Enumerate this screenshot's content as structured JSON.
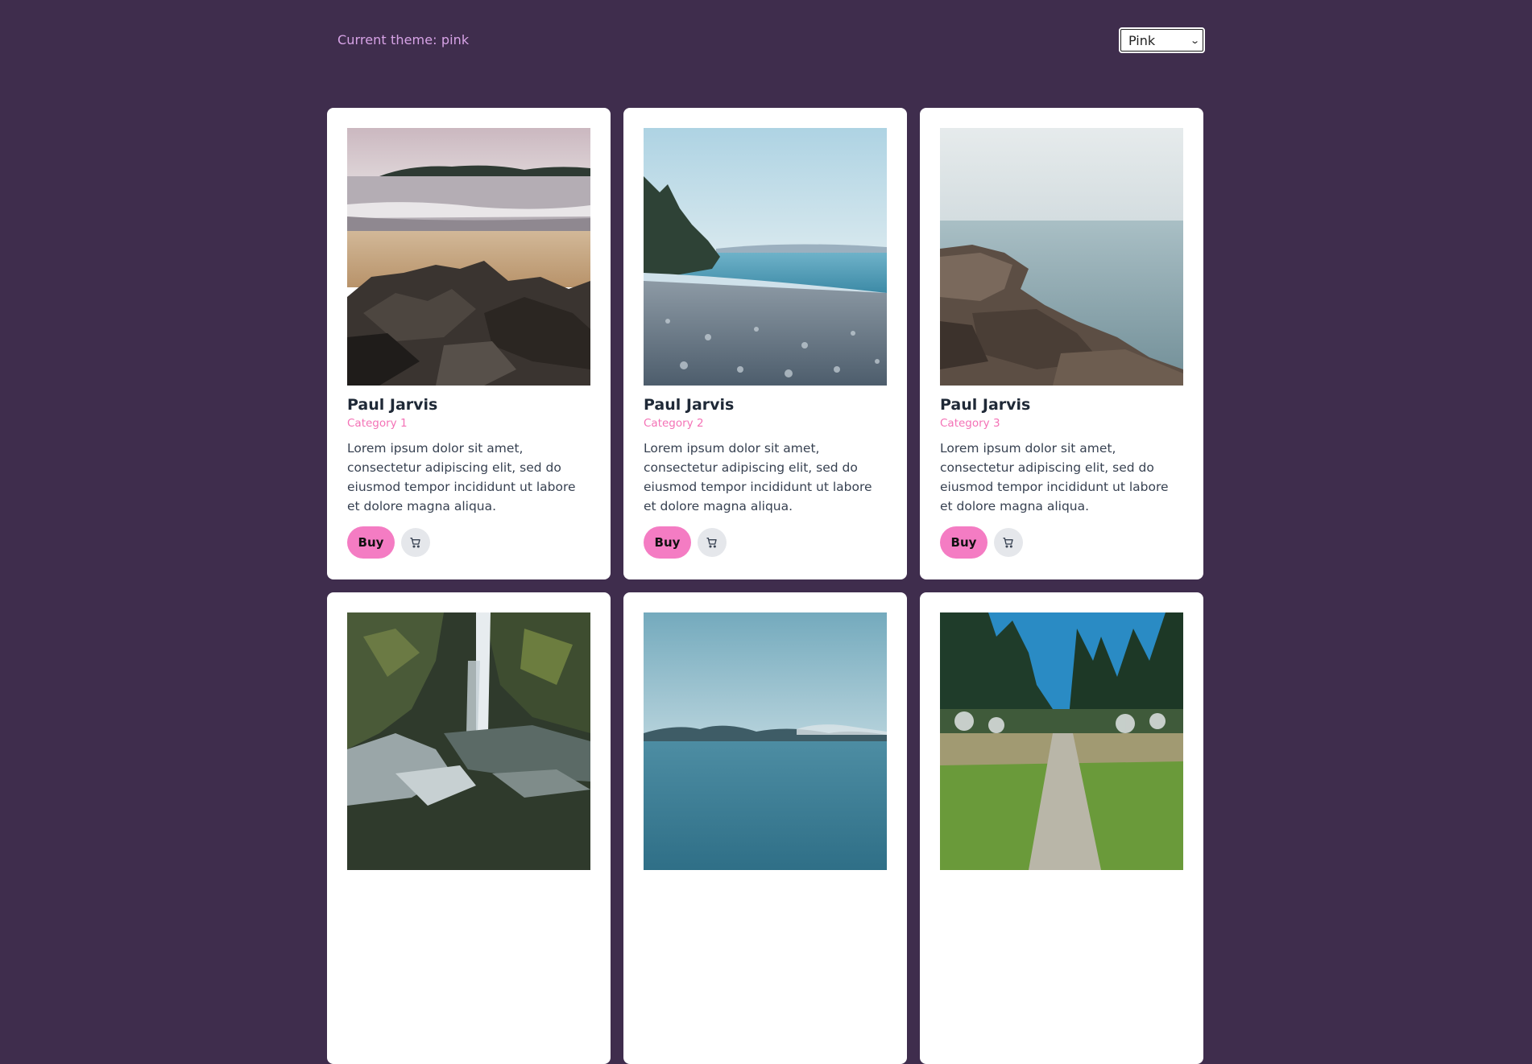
{
  "header": {
    "theme_label": "Current theme: pink",
    "theme_select": {
      "selected": "Pink"
    }
  },
  "colors": {
    "page_background": "#3f2d4d",
    "accent": "#f472b6",
    "buy_button": "#f47cc3",
    "card_background": "#ffffff",
    "cart_button": "#e5e7eb"
  },
  "cards": [
    {
      "author": "Paul Jarvis",
      "category": "Category 1",
      "description": "Lorem ipsum dolor sit amet, consectetur adipiscing elit, sed do eiusmod tempor incididunt ut labore et dolore magna aliqua.",
      "buy_label": "Buy",
      "image": "beach-with-rocks-photo",
      "cart_icon": "cart-icon"
    },
    {
      "author": "Paul Jarvis",
      "category": "Category 2",
      "description": "Lorem ipsum dolor sit amet, consectetur adipiscing elit, sed do eiusmod tempor incididunt ut labore et dolore magna aliqua.",
      "buy_label": "Buy",
      "image": "pebble-beach-photo",
      "cart_icon": "cart-icon"
    },
    {
      "author": "Paul Jarvis",
      "category": "Category 3",
      "description": "Lorem ipsum dolor sit amet, consectetur adipiscing elit, sed do eiusmod tempor incididunt ut labore et dolore magna aliqua.",
      "buy_label": "Buy",
      "image": "rocky-shore-photo",
      "cart_icon": "cart-icon"
    },
    {
      "image": "waterfall-photo"
    },
    {
      "image": "sea-horizon-photo"
    },
    {
      "image": "forest-path-photo"
    }
  ]
}
